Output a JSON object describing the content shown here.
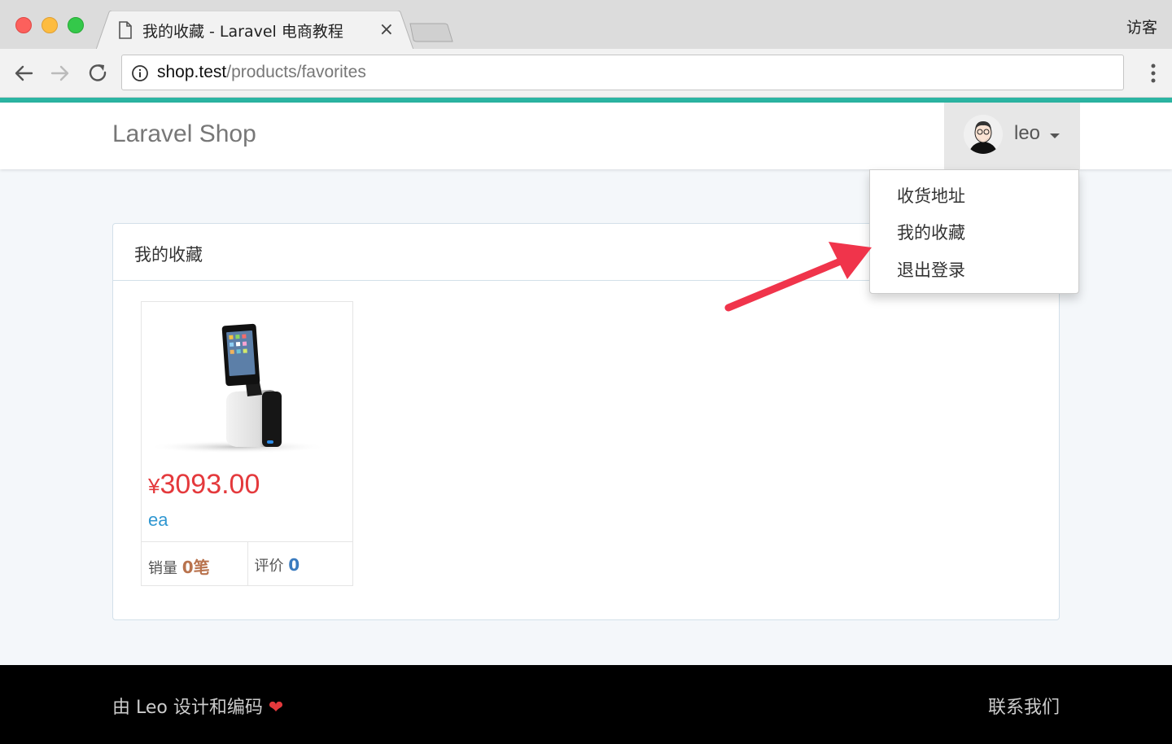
{
  "browser": {
    "tab_title": "我的收藏 - Laravel 电商教程",
    "tab_close": "×",
    "profile_label": "访客",
    "url_host": "shop.test",
    "url_path": "/products/favorites"
  },
  "navbar": {
    "brand": "Laravel Shop",
    "user_name": "leo"
  },
  "dropdown": {
    "items": [
      "收货地址",
      "我的收藏",
      "退出登录"
    ]
  },
  "panel": {
    "title": "我的收藏"
  },
  "products": [
    {
      "currency": "¥",
      "price": "3093.00",
      "title": "ea",
      "sold_label": "销量 ",
      "sold_value": "0笔",
      "review_label": "评价 ",
      "review_value": "0"
    }
  ],
  "footer": {
    "left_text": "由 Leo 设计和编码 ",
    "heart": "❤",
    "right_text": "联系我们"
  },
  "colors": {
    "accent": "#2bb5a3",
    "price": "#e4393c",
    "link": "#3097d1",
    "annotation_arrow": "#f0344b"
  },
  "icons": [
    "page-icon",
    "back-icon",
    "forward-icon",
    "reload-icon",
    "info-icon",
    "menu-icon",
    "caret-down-icon"
  ]
}
